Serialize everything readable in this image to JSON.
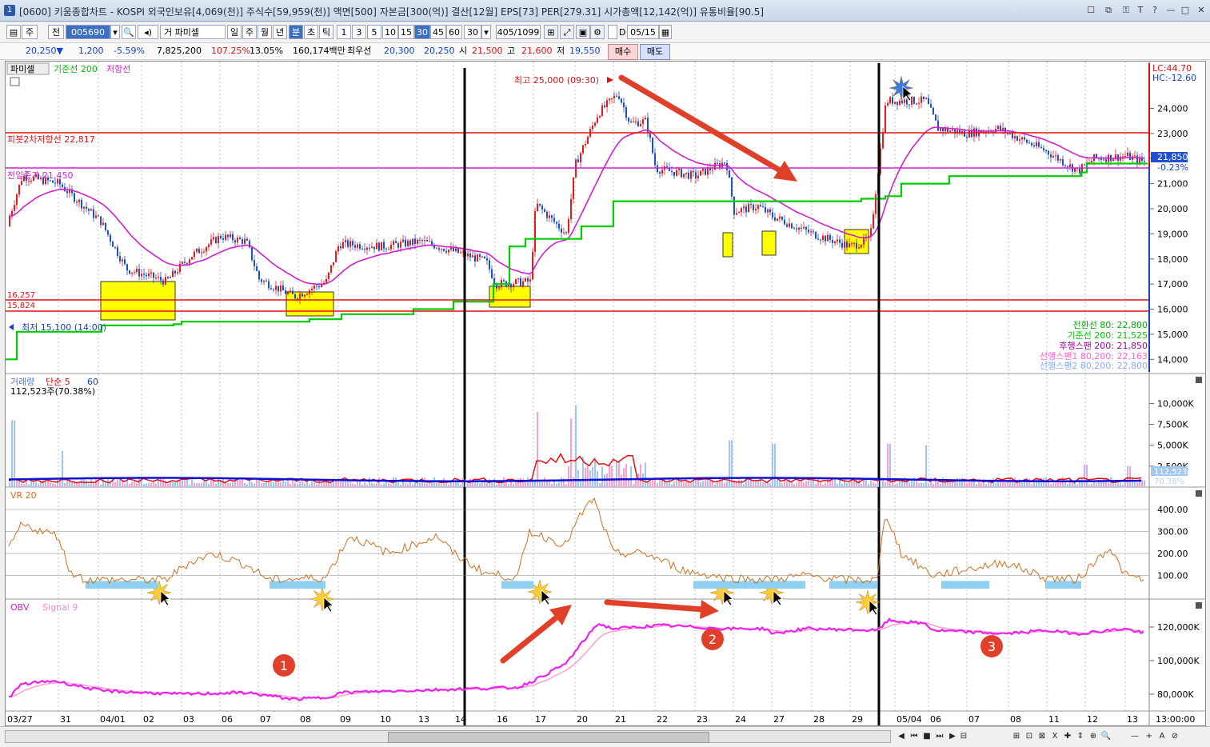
{
  "window": {
    "title": "[0600] 키움종합차트 - KOSPI 외국인보유[4,069(천)] 주식수[59,959(천)] 액면[500] 자본금[300(억)] 결산[12월] EPS[73] PER[279.31] 시가총액[12,142(억)] 유통비율[90.5]",
    "icon_label": "1",
    "buttons": [
      "☐",
      "⧉",
      "⚿",
      "T",
      "?",
      "—",
      "□",
      "✕"
    ]
  },
  "toolbar": {
    "period_label": "주",
    "prev_label": "전",
    "code_value": "005690",
    "search_name": "파미셀",
    "period_buttons": [
      "일",
      "주",
      "월",
      "년",
      "분",
      "초",
      "틱"
    ],
    "active_period": "분",
    "intervals": [
      "1",
      "3",
      "5",
      "10",
      "15",
      "30",
      "45",
      "60"
    ],
    "active_interval": "30",
    "interval_select": "30",
    "page_count": "405/1099",
    "d_label": "D",
    "date_value": "05/15"
  },
  "quote": {
    "price": "20,250▼",
    "change": "1,200",
    "change_pct": "-5.59%",
    "volume": "7,825,200",
    "vol_ratio": "107.25%",
    "turnover": "13.05%",
    "amount": "160,174백만",
    "best_label": "최우선",
    "best_ask": "20,300",
    "best_bid": "20,250",
    "open_label": "시",
    "open": "21,500",
    "high_label": "고",
    "high": "21,600",
    "low_label": "저",
    "low": "19,550",
    "buy_label": "매수",
    "sell_label": "매도"
  },
  "chart_header": {
    "stock": "파미셀",
    "legend_base": "기준선 200",
    "legend_resist": "저항선"
  },
  "price_panel": {
    "ylim": [
      13500,
      25800
    ],
    "yticks": [
      "24,000",
      "23,000",
      "22,000",
      "21,000",
      "20,000",
      "19,000",
      "18,000",
      "17,000",
      "16,000",
      "15,000",
      "14,000"
    ],
    "lc_label": "LC:44.70",
    "hc_label": "HC:-12.60",
    "high_annot": "최고 25,000 (09:30)",
    "low_annot": "최저 15,100 (14:00)",
    "pivot_label": "피봇2차저항선 22,817",
    "prev_close_label": "전일종가 21,450",
    "level_16257": "16,257",
    "level_15824": "15,824",
    "last_price_box": "21,850",
    "last_change_box": "-0.23%",
    "legend_lines": [
      "전환선 80: 22,800",
      "기준선 200: 21,525",
      "후행스팬 200: 21,850",
      "선행스팬1 80,200: 22,163",
      "선행스팬2 80,200: 22,800"
    ],
    "colors": {
      "up": "#e31b1b",
      "down": "#1a4fcf",
      "base": "#00cc00",
      "resist": "#d020d0",
      "hline": "#e81010",
      "highlight": "#ffff00"
    }
  },
  "volume_panel": {
    "title": "거래량",
    "ma_label": "단순 5",
    "ma2_label": "60",
    "current": "112,523주(70.38%)",
    "yticks": [
      "10,000K",
      "7,500K",
      "5,000K",
      "2,500K"
    ],
    "last_box": "112,523",
    "last_pct": "70.38%"
  },
  "vr_panel": {
    "title": "VR 20",
    "yticks": [
      "400.00",
      "300.00",
      "200.00",
      "100.00"
    ]
  },
  "obv_panel": {
    "title": "OBV",
    "signal": "Signal 9",
    "yticks": [
      "120,000K",
      "100,000K",
      "80,000K"
    ],
    "circle_labels": [
      "1",
      "2",
      "3"
    ]
  },
  "xaxis": {
    "labels": [
      "03/27",
      "31",
      "04/01",
      "02",
      "03",
      "06",
      "07",
      "08",
      "09",
      "10",
      "13",
      "14",
      "16",
      "17",
      "20",
      "21",
      "22",
      "23",
      "24",
      "27",
      "28",
      "29",
      "05/04",
      "06",
      "07",
      "08",
      "11",
      "12",
      "13"
    ],
    "time_label": "13:00:00"
  },
  "bottom_controls": [
    "◀",
    "⏮",
    "■",
    "⏭",
    "▶",
    "⊟",
    "⊞",
    "⊡",
    "⊠",
    "Ⅹ",
    "✚",
    "⇕",
    "⊕",
    "🔍",
    "—",
    "+",
    "A",
    "⊘"
  ]
}
